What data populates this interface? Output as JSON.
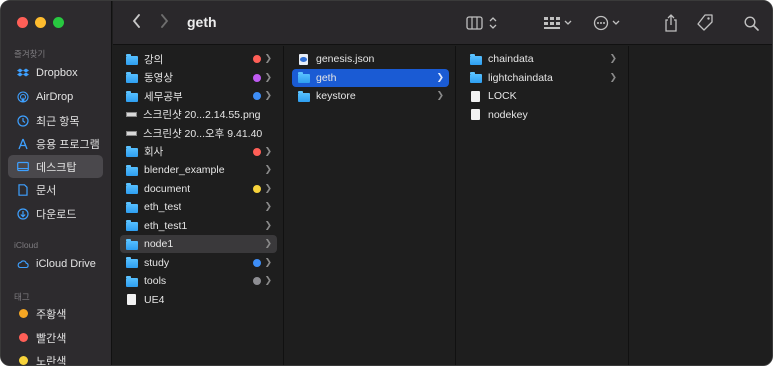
{
  "window": {
    "title": "geth"
  },
  "colors": {
    "accent": "#1a5bd4",
    "folder": "#3ea0ff"
  },
  "sidebar": {
    "sections": {
      "favorites": "즐겨찾기",
      "icloud": "iCloud",
      "tags": "태그"
    },
    "favorites": [
      {
        "label": "Dropbox",
        "icon": "dropbox-icon"
      },
      {
        "label": "AirDrop",
        "icon": "airdrop-icon"
      },
      {
        "label": "최근 항목",
        "icon": "clock-icon"
      },
      {
        "label": "응용 프로그램",
        "icon": "applications-icon"
      },
      {
        "label": "데스크탑",
        "icon": "desktop-icon",
        "selected": true
      },
      {
        "label": "문서",
        "icon": "document-icon"
      },
      {
        "label": "다운로드",
        "icon": "download-icon"
      }
    ],
    "icloud": [
      {
        "label": "iCloud Drive",
        "icon": "cloud-icon"
      }
    ],
    "tags": [
      {
        "label": "주황색",
        "color": "#f5a623"
      },
      {
        "label": "빨간색",
        "color": "#ff5f57"
      },
      {
        "label": "노란색",
        "color": "#f7d33b"
      }
    ]
  },
  "toolbar": {
    "back": "‹",
    "forward": "›",
    "view_icon": "column-view-icon",
    "group_icon": "group-icon",
    "action_icon": "more-icon",
    "share_icon": "share-icon",
    "tag_icon": "tag-icon",
    "search_icon": "search-icon"
  },
  "columns": [
    {
      "items": [
        {
          "label": "강의",
          "type": "folder",
          "tag": "#ff5f57",
          "chevron": true
        },
        {
          "label": "동영상",
          "type": "folder",
          "tag": "#bf5af2",
          "chevron": true
        },
        {
          "label": "세무공부",
          "type": "folder",
          "tag": "#3e8ef7",
          "chevron": true
        },
        {
          "label": "스크린샷 20...2.14.55.png",
          "type": "image"
        },
        {
          "label": "스크린샷 20...오후 9.41.40",
          "type": "image"
        },
        {
          "label": "회사",
          "type": "folder",
          "tag": "#ff5f57",
          "chevron": true
        },
        {
          "label": "blender_example",
          "type": "folder",
          "chevron": true
        },
        {
          "label": "document",
          "type": "folder",
          "tag": "#f7d33b",
          "chevron": true
        },
        {
          "label": "eth_test",
          "type": "folder",
          "chevron": true
        },
        {
          "label": "eth_test1",
          "type": "folder",
          "chevron": true
        },
        {
          "label": "node1",
          "type": "folder",
          "chevron": true,
          "selected": "gray"
        },
        {
          "label": "study",
          "type": "folder",
          "tag": "#3e8ef7",
          "chevron": true
        },
        {
          "label": "tools",
          "type": "folder",
          "tag": "#8e8e93",
          "chevron": true
        },
        {
          "label": "UE4",
          "type": "doc"
        }
      ]
    },
    {
      "items": [
        {
          "label": "genesis.json",
          "type": "json"
        },
        {
          "label": "geth",
          "type": "folder",
          "chevron": true,
          "selected": "blue"
        },
        {
          "label": "keystore",
          "type": "folder",
          "chevron": true
        }
      ]
    },
    {
      "items": [
        {
          "label": "chaindata",
          "type": "folder",
          "chevron": true
        },
        {
          "label": "lightchaindata",
          "type": "folder",
          "chevron": true
        },
        {
          "label": "LOCK",
          "type": "doc"
        },
        {
          "label": "nodekey",
          "type": "doc"
        }
      ]
    }
  ]
}
